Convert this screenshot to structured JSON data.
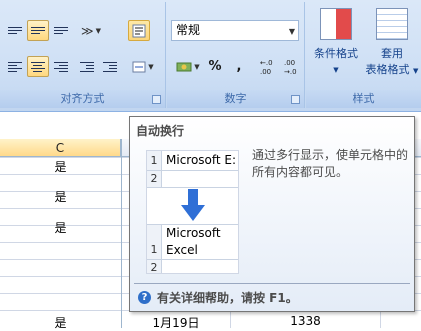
{
  "ribbon": {
    "groups": {
      "alignment": {
        "label": "对齐方式"
      },
      "number": {
        "label": "数字",
        "format_value": "常规",
        "buttons": [
          {
            "name": "currency",
            "label": "",
            "icon": "currency-icon"
          },
          {
            "name": "percent",
            "label": "%",
            "icon": ""
          },
          {
            "name": "comma",
            "label": ",",
            "icon": ""
          },
          {
            "name": "increase-decimal",
            "label": "←.0 .00",
            "icon": ""
          },
          {
            "name": "decrease-decimal",
            "label": ".00 →.0",
            "icon": ""
          }
        ]
      },
      "styles": {
        "label": "样式",
        "conditional_format": "条件格式",
        "table_format_line1": "套用",
        "table_format_line2": "表格格式"
      }
    }
  },
  "sheet": {
    "column_header": "C",
    "cells": [
      "是",
      "是",
      "是",
      "是",
      "1月19日",
      "1338"
    ]
  },
  "tooltip": {
    "title": "自动换行",
    "description": "通过多行显示，使单元格中的所有内容都可见。",
    "demo": {
      "row1": "1",
      "row2": "2",
      "before_text": "Microsoft E:",
      "after_line1": "Microsoft",
      "after_line2": "Excel",
      "row1b": "1",
      "row2b": "2"
    },
    "help_text": "有关详细帮助，请按 F1。"
  }
}
